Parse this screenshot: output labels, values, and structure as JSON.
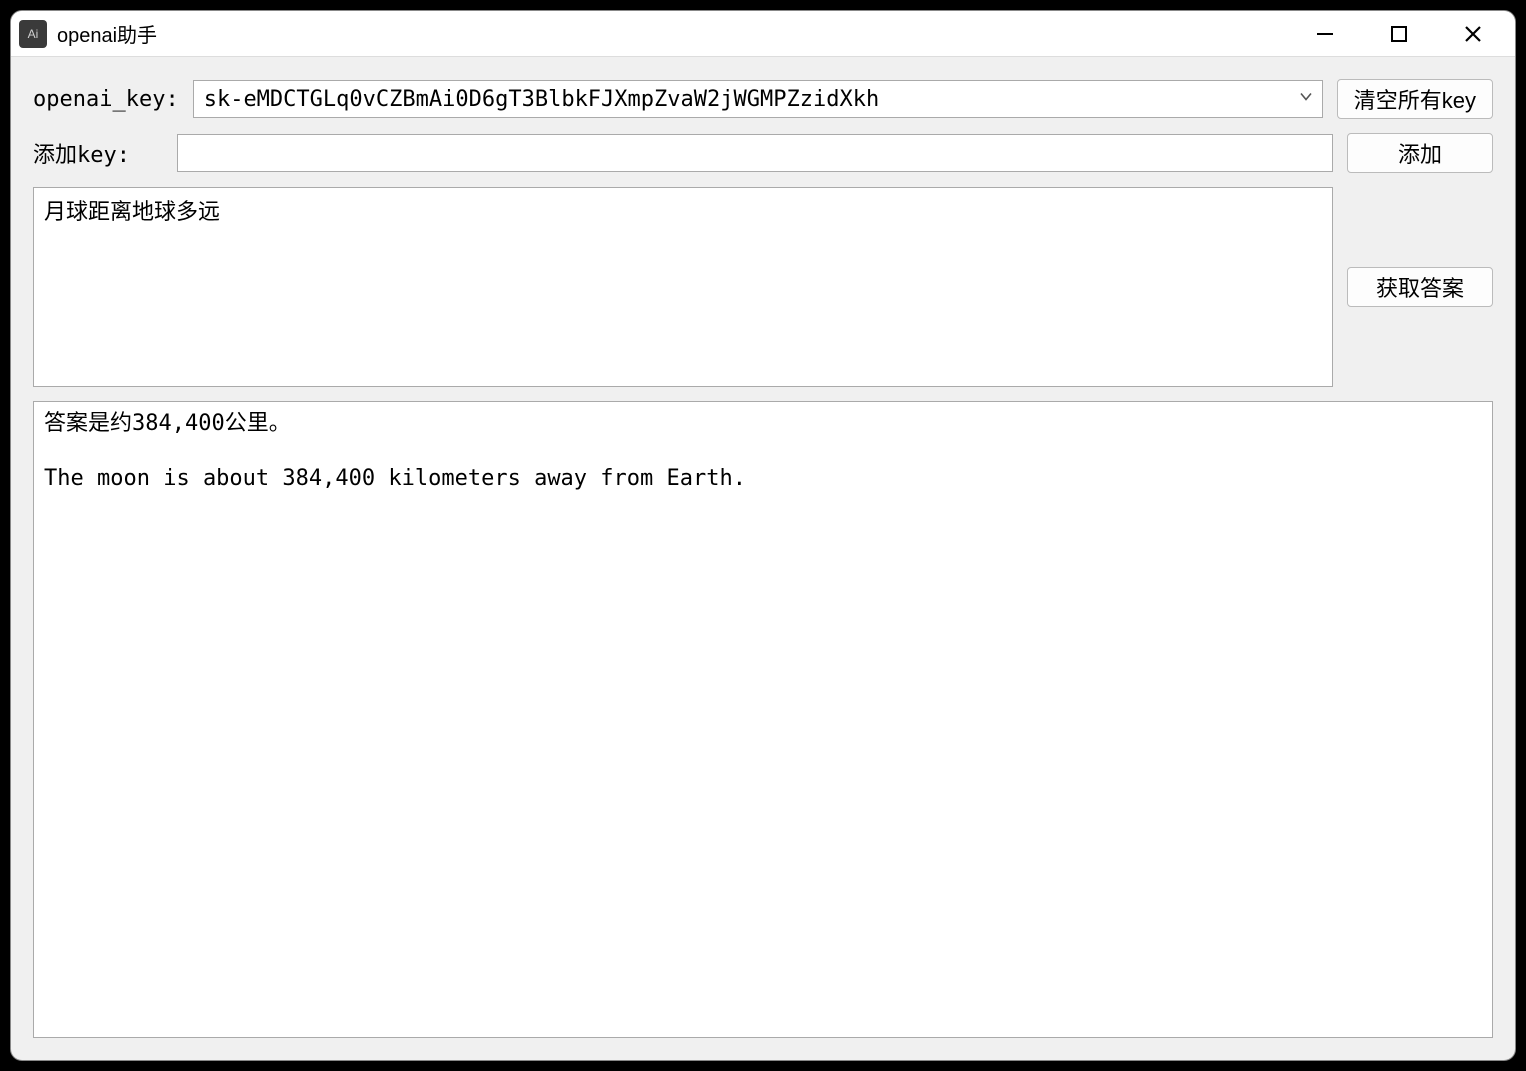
{
  "window": {
    "title": "openai助手",
    "app_icon_text": "Ai"
  },
  "form": {
    "openai_key_label": "openai_key:",
    "openai_key_value": "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",
    "add_key_label": "添加key:",
    "add_key_value": ""
  },
  "buttons": {
    "clear_all_keys": "清空所有key",
    "add": "添加",
    "get_answer": "获取答案"
  },
  "question": {
    "text": "月球距离地球多远"
  },
  "answer": {
    "text": "答案是约384,400公里。\n\nThe moon is about 384,400 kilometers away from Earth."
  }
}
